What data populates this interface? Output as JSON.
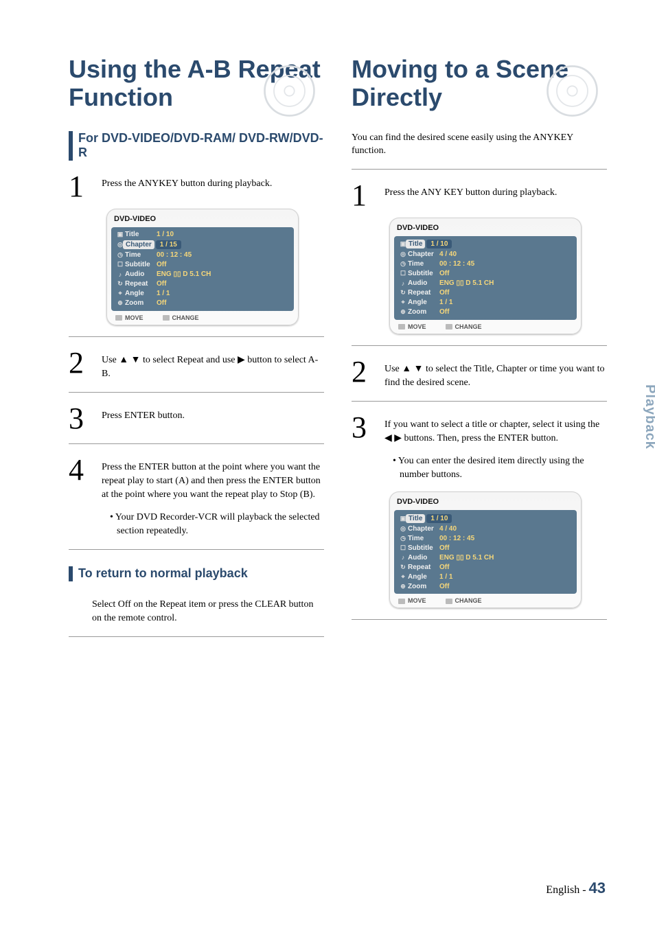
{
  "left": {
    "title": "Using the A-B Repeat Function",
    "sub1": "For DVD-VIDEO/DVD-RAM/ DVD-RW/DVD-R",
    "step1": "Press the ANYKEY button during playback.",
    "step2": "Use ▲ ▼ to select Repeat and use ▶ button to select A-B.",
    "step3": "Press ENTER button.",
    "step4": "Press the ENTER button at the point where you want the repeat play to start (A) and then press the ENTER button at the point where you want the repeat play to Stop (B).",
    "step4_bullet": "• Your DVD Recorder-VCR will playback the selected section repeatedly.",
    "sub2": "To return to normal playback",
    "return_text": "Select Off on the Repeat item or press the CLEAR button on the remote control."
  },
  "right": {
    "title": "Moving to a Scene Directly",
    "intro": "You can find the desired scene easily using the ANYKEY function.",
    "step1": "Press the ANY KEY button during playback.",
    "step2": "Use ▲ ▼ to select the Title, Chapter or time you want to find the desired scene.",
    "step3": "If you want to select a title or chapter, select it using the ◀ ▶ buttons. Then, press the ENTER button.",
    "step3_bullet": "• You can enter the desired item directly using the number buttons."
  },
  "osd": {
    "heading": "DVD-VIDEO",
    "rows": {
      "title_label": "Title",
      "chapter_label": "Chapter",
      "time_label": "Time",
      "subtitle_label": "Subtitle",
      "audio_label": "Audio",
      "repeat_label": "Repeat",
      "angle_label": "Angle",
      "zoom_label": "Zoom"
    },
    "left_vals": {
      "title": "1 / 10",
      "chapter": "1 / 15",
      "time": "00 : 12 : 45",
      "subtitle": "Off",
      "audio": "ENG ▯▯ D 5.1 CH",
      "repeat": "Off",
      "angle": "1 / 1",
      "zoom": "Off"
    },
    "right_vals": {
      "title": "1 / 10",
      "chapter": "4 / 40",
      "time": "00 : 12 : 45",
      "subtitle": "Off",
      "audio": "ENG ▯▯ D 5.1 CH",
      "repeat": "Off",
      "angle": "1 / 1",
      "zoom": "Off"
    },
    "foot_move": "MOVE",
    "foot_change": "CHANGE"
  },
  "side_tab": "Playback",
  "footer_lang": "English - ",
  "footer_page": "43"
}
